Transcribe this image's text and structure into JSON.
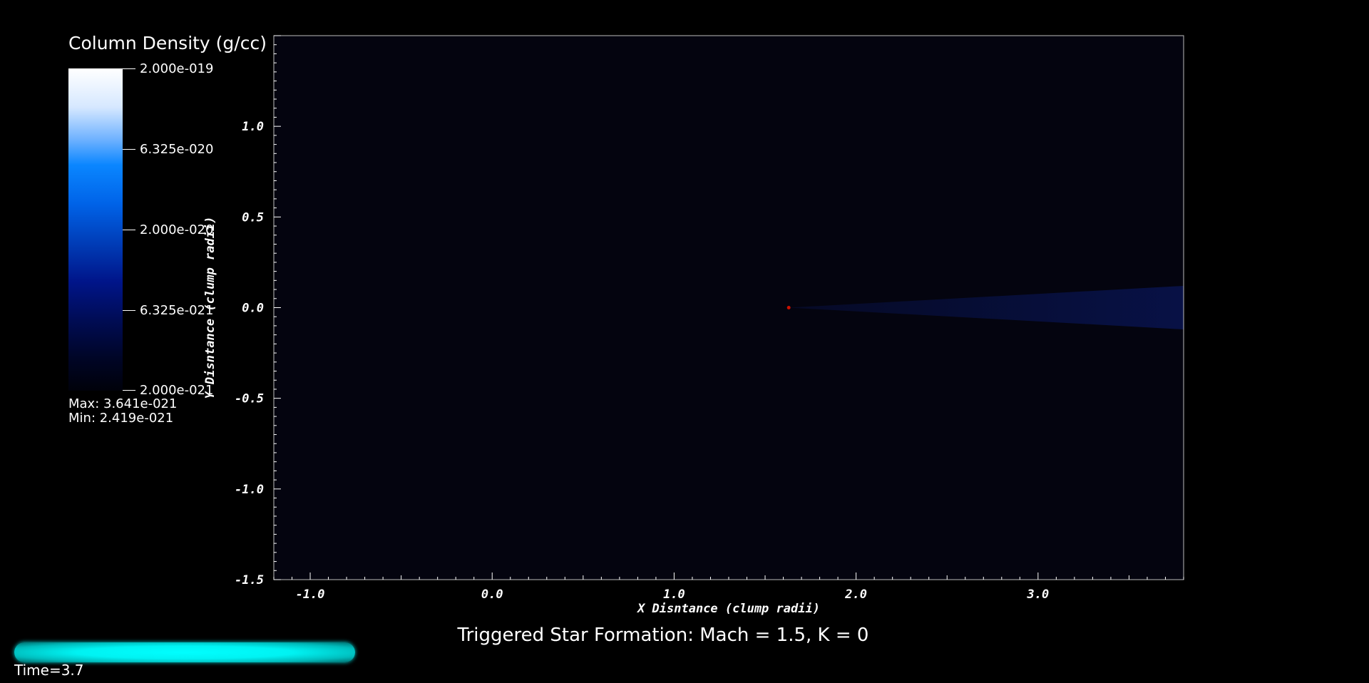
{
  "legend": {
    "title": "Column Density (g/cc)",
    "ticks": [
      "2.000e-019",
      "6.325e-020",
      "2.000e-020",
      "6.325e-021",
      "2.000e-021"
    ],
    "max_text": "Max:  3.641e-021",
    "min_text": "Min:  2.419e-021"
  },
  "caption": "Triggered Star Formation: Mach = 1.5, K = 0",
  "time": {
    "label": "Time=3.7",
    "progress": 1.0
  },
  "colors": {
    "background": "#000000",
    "plot_bg": "#04040f",
    "marker": "#cc1100",
    "time_bar": "#00ffff"
  },
  "chart_data": {
    "type": "heatmap",
    "xlabel": "X Disntance (clump radii)",
    "ylabel": "Y Disntance (clump radii)",
    "xlim": [
      -1.2,
      3.8
    ],
    "ylim": [
      -1.5,
      1.5
    ],
    "xticks": [
      -1.0,
      0.0,
      1.0,
      2.0,
      3.0
    ],
    "xtick_labels": [
      "-1.0",
      "0.0",
      "1.0",
      "2.0",
      "3.0"
    ],
    "yticks": [
      1.0,
      0.5,
      0.0,
      -0.5,
      -1.0,
      -1.5
    ],
    "ytick_labels": [
      "1.0",
      "0.5",
      "0.0",
      "-0.5",
      "-1.0",
      "-1.5"
    ],
    "grid": false,
    "marker": {
      "x": 1.63,
      "y": 0.0
    },
    "tail": {
      "x_start": 1.63,
      "x_end": 3.8,
      "y_center": 0.0,
      "half_width_end": 0.12
    }
  }
}
